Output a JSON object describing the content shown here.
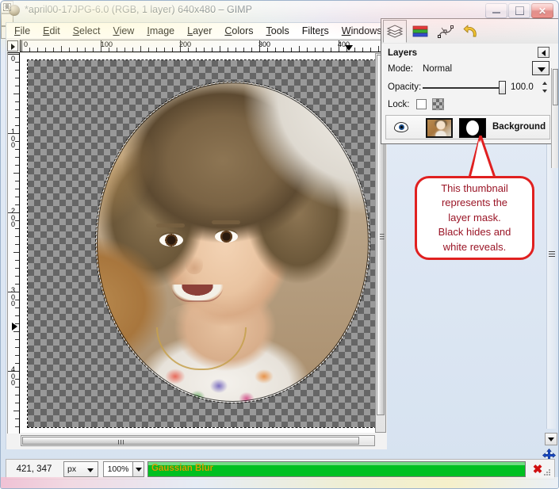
{
  "window": {
    "title": "*april00-17JPG-6.0 (RGB, 1 layer) 640x480 – GIMP",
    "icon": "gimp-wilber-icon",
    "controls": {
      "minimize": "Minimize",
      "maximize": "Maximize",
      "close": "Close"
    }
  },
  "menubar": {
    "items": [
      {
        "label": "File",
        "mnemonic": "F"
      },
      {
        "label": "Edit",
        "mnemonic": "E"
      },
      {
        "label": "Select",
        "mnemonic": "S"
      },
      {
        "label": "View",
        "mnemonic": "V"
      },
      {
        "label": "Image",
        "mnemonic": "I"
      },
      {
        "label": "Layer",
        "mnemonic": "L"
      },
      {
        "label": "Colors",
        "mnemonic": "C"
      },
      {
        "label": "Tools",
        "mnemonic": "T"
      },
      {
        "label": "Filters",
        "mnemonic": "r"
      },
      {
        "label": "Windows",
        "mnemonic": "W"
      },
      {
        "label": "Help",
        "mnemonic": "H"
      }
    ]
  },
  "rulers": {
    "horizontal_labels": [
      "0",
      "100",
      "200",
      "300",
      "400"
    ],
    "vertical_labels": [
      "0",
      "100",
      "200",
      "300",
      "400"
    ],
    "unit": "px"
  },
  "canvas": {
    "description": "Photograph of a smiling young girl with curly hair on a wooden floor, cropped to an elliptical layer mask; area outside the ellipse shows the transparency checkerboard.",
    "selection": "elliptical-selection",
    "background": "transparency-checkerboard"
  },
  "dock": {
    "tabs": [
      {
        "name": "layers-tab",
        "icon": "layers-stack-icon",
        "label": "Layers",
        "active": true
      },
      {
        "name": "channels-tab",
        "icon": "channels-books-icon",
        "label": "Channels",
        "active": false
      },
      {
        "name": "paths-tab",
        "icon": "paths-nodes-icon",
        "label": "Paths",
        "active": false
      },
      {
        "name": "undo-history-tab",
        "icon": "undo-arrow-icon",
        "label": "Undo History",
        "active": false
      }
    ],
    "title": "Layers",
    "mode": {
      "label": "Mode:",
      "value": "Normal"
    },
    "opacity": {
      "label": "Opacity:",
      "value": "100.0"
    },
    "lock": {
      "label": "Lock:"
    },
    "layer": {
      "name": "Background",
      "visible": true,
      "thumbnail": "layer-thumbnail-photo",
      "mask_thumbnail": "layer-mask-thumbnail-black-with-white-circle"
    }
  },
  "callout": {
    "text": "This thumbnail\nrepresents the\nlayer mask.\nBlack hides and\nwhite reveals.",
    "border_color": "#e02020",
    "text_color": "#9a1526",
    "points_to": "layer-mask-thumbnail"
  },
  "statusbar": {
    "pointer_position": "421, 347",
    "unit": "px",
    "zoom": "100%",
    "progress_label": "Gaussian Blur",
    "progress_color": "#00c020",
    "cancel": "✖"
  }
}
